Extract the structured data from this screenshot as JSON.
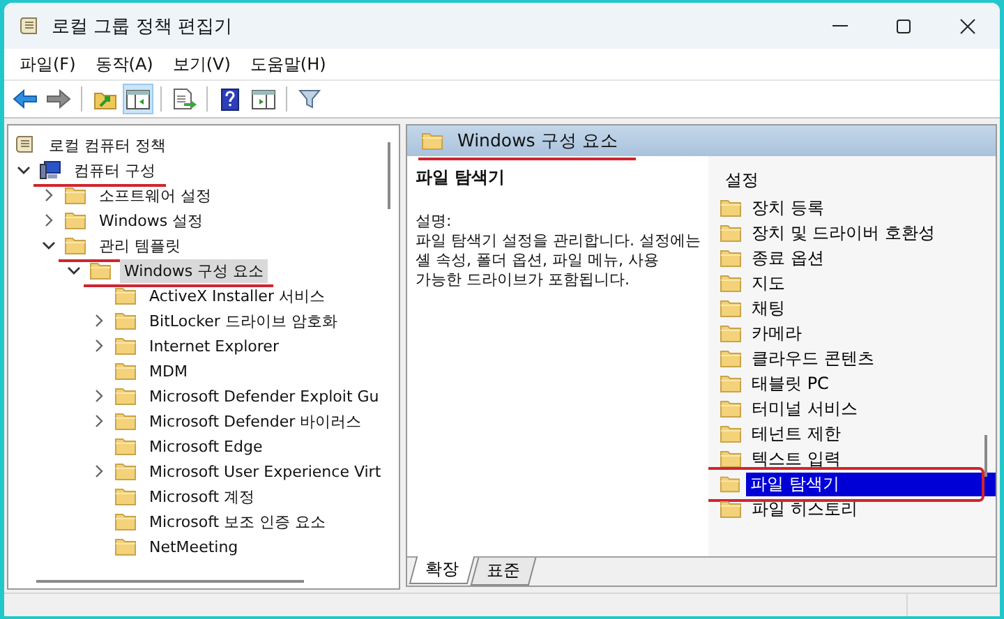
{
  "window": {
    "title": "로컬 그룹 정책 편집기"
  },
  "menu": [
    "파일(F)",
    "동작(A)",
    "보기(V)",
    "도움말(H)"
  ],
  "toolbar": [
    {
      "kind": "back",
      "pressed": false
    },
    {
      "kind": "forward",
      "pressed": false
    },
    {
      "kind": "sep"
    },
    {
      "kind": "up",
      "pressed": false
    },
    {
      "kind": "tree",
      "pressed": true
    },
    {
      "kind": "sep"
    },
    {
      "kind": "export",
      "pressed": false
    },
    {
      "kind": "sep"
    },
    {
      "kind": "help",
      "pressed": false
    },
    {
      "kind": "pane",
      "pressed": false
    },
    {
      "kind": "sep"
    },
    {
      "kind": "filter",
      "pressed": false
    }
  ],
  "tree": [
    {
      "label": "로컬 컴퓨터 정책",
      "kind": "policy",
      "selected": false,
      "annotated": false,
      "children": [
        {
          "label": "컴퓨터 구성",
          "kind": "computer",
          "has_children": true,
          "expanded": true,
          "selected": false,
          "annotated": true,
          "children": [
            {
              "label": "소프트웨어 설정",
              "kind": "folder",
              "has_children": true,
              "expanded": false,
              "selected": false,
              "annotated": false
            },
            {
              "label": "Windows 설정",
              "kind": "folder",
              "has_children": true,
              "expanded": false,
              "selected": false,
              "annotated": false
            },
            {
              "label": "관리 템플릿",
              "kind": "folder",
              "has_children": true,
              "expanded": true,
              "selected": false,
              "annotated": true,
              "children": [
                {
                  "label": "Windows 구성 요소",
                  "kind": "folder",
                  "has_children": true,
                  "expanded": true,
                  "selected": true,
                  "annotated": true,
                  "children": [
                    {
                      "label": "ActiveX Installer 서비스",
                      "kind": "folder",
                      "has_children": false,
                      "selected": false,
                      "annotated": false
                    },
                    {
                      "label": "BitLocker 드라이브 암호화",
                      "kind": "folder",
                      "has_children": true,
                      "expanded": false,
                      "selected": false,
                      "annotated": false
                    },
                    {
                      "label": "Internet Explorer",
                      "kind": "folder",
                      "has_children": true,
                      "expanded": false,
                      "selected": false,
                      "annotated": false
                    },
                    {
                      "label": "MDM",
                      "kind": "folder",
                      "has_children": false,
                      "selected": false,
                      "annotated": false
                    },
                    {
                      "label": "Microsoft Defender Exploit Gu",
                      "kind": "folder",
                      "has_children": true,
                      "expanded": false,
                      "selected": false,
                      "annotated": false
                    },
                    {
                      "label": "Microsoft Defender 바이러스",
                      "kind": "folder",
                      "has_children": true,
                      "expanded": false,
                      "selected": false,
                      "annotated": false
                    },
                    {
                      "label": "Microsoft Edge",
                      "kind": "folder",
                      "has_children": false,
                      "selected": false,
                      "annotated": false
                    },
                    {
                      "label": "Microsoft User Experience Virt",
                      "kind": "folder",
                      "has_children": true,
                      "expanded": false,
                      "selected": false,
                      "annotated": false
                    },
                    {
                      "label": "Microsoft 계정",
                      "kind": "folder",
                      "has_children": false,
                      "selected": false,
                      "annotated": false
                    },
                    {
                      "label": "Microsoft 보조 인증 요소",
                      "kind": "folder",
                      "has_children": false,
                      "selected": false,
                      "annotated": false
                    },
                    {
                      "label": "NetMeeting",
                      "kind": "folder",
                      "has_children": false,
                      "selected": false,
                      "annotated": false
                    }
                  ]
                }
              ]
            }
          ]
        }
      ]
    }
  ],
  "detail": {
    "header": "Windows 구성 요소",
    "header_annotated": true,
    "title": "파일 탐색기",
    "description_label": "설명:",
    "description": "파일 탐색기 설정을 관리합니다. 설정에는 셸 속성, 폴더 옵션, 파일 메뉴, 사용 가능한 드라이브가 포함됩니다.",
    "list_header": "설정",
    "items": [
      {
        "label": "장치 등록",
        "selected": false,
        "annotated": false
      },
      {
        "label": "장치 및 드라이버 호환성",
        "selected": false,
        "annotated": false
      },
      {
        "label": "종료 옵션",
        "selected": false,
        "annotated": false
      },
      {
        "label": "지도",
        "selected": false,
        "annotated": false
      },
      {
        "label": "채팅",
        "selected": false,
        "annotated": false
      },
      {
        "label": "카메라",
        "selected": false,
        "annotated": false
      },
      {
        "label": "클라우드 콘텐츠",
        "selected": false,
        "annotated": false
      },
      {
        "label": "태블릿 PC",
        "selected": false,
        "annotated": false
      },
      {
        "label": "터미널 서비스",
        "selected": false,
        "annotated": false
      },
      {
        "label": "테넌트 제한",
        "selected": false,
        "annotated": false
      },
      {
        "label": "텍스트 입력",
        "selected": false,
        "annotated": false
      },
      {
        "label": "파일 탐색기",
        "selected": true,
        "annotated": true
      },
      {
        "label": "파일 히스토리",
        "selected": false,
        "annotated": false
      }
    ],
    "tabs": [
      {
        "label": "확장",
        "selected": true
      },
      {
        "label": "표준",
        "selected": false
      }
    ]
  }
}
